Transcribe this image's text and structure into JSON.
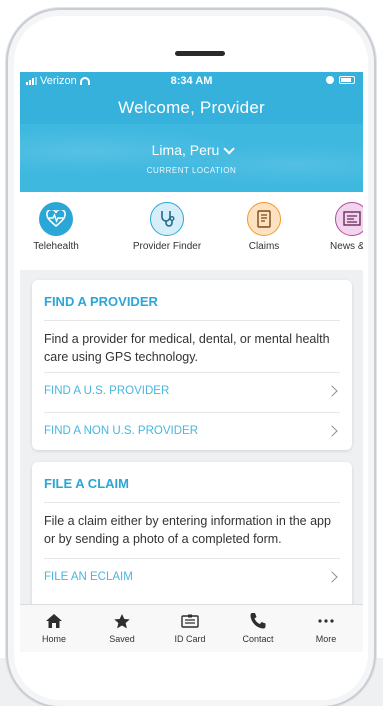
{
  "status_bar": {
    "carrier": "Verizon",
    "time": "8:34 AM"
  },
  "header": {
    "title": "Welcome, Provider"
  },
  "location": {
    "name": "Lima, Peru",
    "label": "CURRENT LOCATION"
  },
  "quick_actions": [
    {
      "label": "Telehealth",
      "icon": "heart-pulse-icon",
      "color": "#2aa7d6"
    },
    {
      "label": "Provider Finder",
      "icon": "stethoscope-icon",
      "color": "#2aa7d6"
    },
    {
      "label": "Claims",
      "icon": "document-icon",
      "color": "#f29a2e"
    },
    {
      "label": "News & S",
      "icon": "news-icon",
      "color": "#b24aa0"
    }
  ],
  "cards": [
    {
      "title": "FIND A PROVIDER",
      "description": "Find a provider for medical, dental, or mental health care using GPS technology.",
      "links": [
        "FIND A U.S. PROVIDER",
        "FIND A NON U.S. PROVIDER"
      ]
    },
    {
      "title": "FILE A CLAIM",
      "description": "File a claim either by entering information in the app or by sending a photo of a completed form.",
      "links": [
        "FILE AN ECLAIM"
      ]
    }
  ],
  "tab_bar": [
    {
      "label": "Home",
      "icon": "home-icon"
    },
    {
      "label": "Saved",
      "icon": "star-icon"
    },
    {
      "label": "ID Card",
      "icon": "id-card-icon"
    },
    {
      "label": "Contact",
      "icon": "phone-icon"
    },
    {
      "label": "More",
      "icon": "more-icon"
    }
  ],
  "colors": {
    "header": "#35b1dc",
    "accent": "#2aa7d6",
    "link": "#48b6de"
  }
}
